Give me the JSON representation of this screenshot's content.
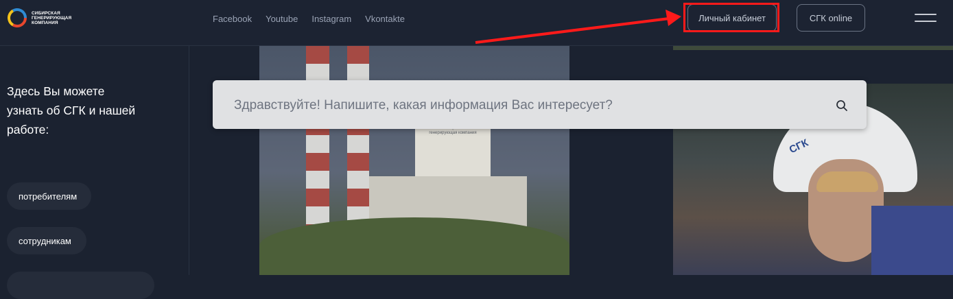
{
  "logo": {
    "text": "Сибирская генерирующая компания",
    "colors": [
      "#e8472d",
      "#f4c21a",
      "#2f8bd3"
    ]
  },
  "social": [
    "Facebook",
    "Youtube",
    "Instagram",
    "Vkontakte"
  ],
  "header": {
    "cabinet_label": "Личный кабинет",
    "online_label": "СГК online",
    "highlight_color": "#ff1a1a"
  },
  "sidebar": {
    "intro": "Здесь Вы можете узнать об СГК и нашей работе:",
    "pills": [
      "потребителям",
      "сотрудникам",
      ""
    ]
  },
  "search": {
    "placeholder": "Здравствуйте! Напишите, какая информация Вас интересует?"
  },
  "photos": {
    "plant_sign": "Сибирская генерирующая компания",
    "helmet_logo": "СГК"
  }
}
